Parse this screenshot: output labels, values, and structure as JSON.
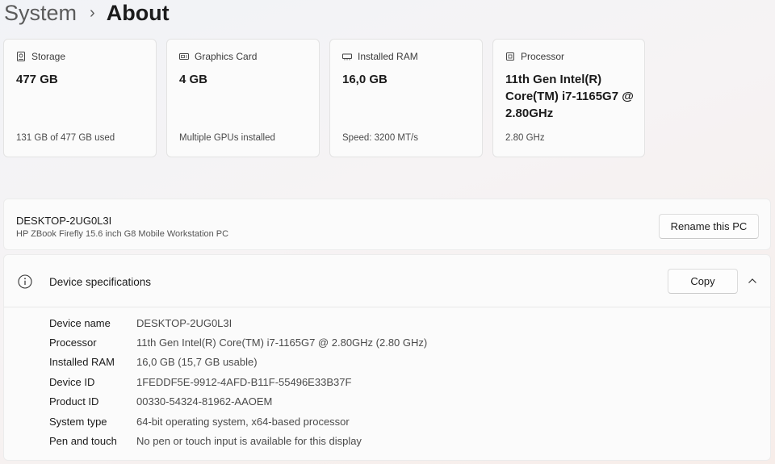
{
  "breadcrumb": {
    "parent": "System",
    "separator": "›",
    "current": "About"
  },
  "cards": [
    {
      "label": "Storage",
      "value": "477 GB",
      "sub": "131 GB of 477 GB used",
      "icon": "storage-icon"
    },
    {
      "label": "Graphics Card",
      "value": "4 GB",
      "sub": "Multiple GPUs installed",
      "icon": "graphics-card-icon"
    },
    {
      "label": "Installed RAM",
      "value": "16,0 GB",
      "sub": "Speed: 3200 MT/s",
      "icon": "ram-icon"
    },
    {
      "label": "Processor",
      "value": "11th Gen Intel(R) Core(TM) i7-1165G7 @ 2.80GHz",
      "sub": "2.80 GHz",
      "icon": "processor-icon"
    }
  ],
  "device": {
    "name": "DESKTOP-2UG0L3I",
    "model": "HP ZBook Firefly 15.6 inch G8 Mobile Workstation PC",
    "rename_label": "Rename this PC"
  },
  "specs": {
    "title": "Device specifications",
    "copy_label": "Copy",
    "rows": [
      {
        "key": "Device name",
        "value": "DESKTOP-2UG0L3I"
      },
      {
        "key": "Processor",
        "value": "11th Gen Intel(R) Core(TM) i7-1165G7 @ 2.80GHz (2.80 GHz)"
      },
      {
        "key": "Installed RAM",
        "value": "16,0 GB (15,7 GB usable)"
      },
      {
        "key": "Device ID",
        "value": "1FEDDF5E-9912-4AFD-B11F-55496E33B37F"
      },
      {
        "key": "Product ID",
        "value": "00330-54324-81962-AAOEM"
      },
      {
        "key": "System type",
        "value": "64-bit operating system, x64-based processor"
      },
      {
        "key": "Pen and touch",
        "value": "No pen or touch input is available for this display"
      }
    ]
  }
}
